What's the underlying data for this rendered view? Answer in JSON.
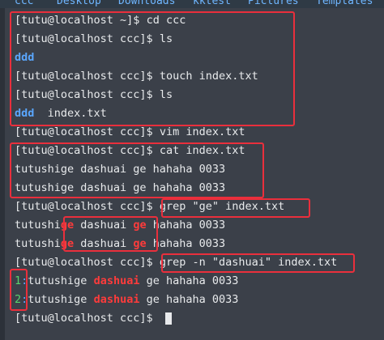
{
  "top_bar": {
    "folders": [
      "ccc",
      "Desktop",
      "Downloads",
      "kktest",
      "Pictures",
      "Templates"
    ]
  },
  "terminal": {
    "lines": [
      {
        "prompt": "[tutu@localhost ~]$",
        "cmd": " cd ccc"
      },
      {
        "prompt": "[tutu@localhost ccc]$",
        "cmd": " ls"
      },
      {
        "dir": "ddd"
      },
      {
        "prompt": "[tutu@localhost ccc]$",
        "cmd": " touch index.txt"
      },
      {
        "prompt": "[tutu@localhost ccc]$",
        "cmd": " ls"
      },
      {
        "dir": "ddd",
        "rest": "  index.txt"
      },
      {
        "prompt": "[tutu@localhost ccc]$",
        "cmd": " vim index.txt"
      },
      {
        "prompt": "[tutu@localhost ccc]$",
        "cmd": " cat index.txt"
      },
      {
        "text": "tutushige dashuai ge hahaha 0033"
      },
      {
        "text": "tutushige dashuai ge hahaha 0033"
      },
      {
        "prompt": "[tutu@localhost ccc]$",
        "cmd": " grep \"ge\" index.txt"
      },
      {
        "pre": "tutushi",
        "m1": "ge",
        "mid": " dashuai ",
        "m2": "ge",
        "post": " hahaha 0033"
      },
      {
        "pre": "tutushi",
        "m1": "ge",
        "mid": " dashuai ",
        "m2": "ge",
        "post": " hahaha 0033"
      },
      {
        "prompt": "[tutu@localhost ccc]$",
        "cmd": " grep -n \"dashuai\" index.txt"
      },
      {
        "num": "1",
        "sep": ":",
        "pre": "tutushige ",
        "m1": "dashuai",
        "post": " ge hahaha 0033"
      },
      {
        "num": "2",
        "sep": ":",
        "pre": "tutushige ",
        "m1": "dashuai",
        "post": " ge hahaha 0033"
      },
      {
        "prompt": "[tutu@localhost ccc]$",
        "cmd": " "
      }
    ]
  },
  "colors": {
    "background": "#3b4049",
    "text": "#e8eaec",
    "directory": "#5aa7ff",
    "grep_match": "#ff3b3b",
    "line_number": "#57d36d",
    "annotation_box": "#ea2f3c"
  }
}
